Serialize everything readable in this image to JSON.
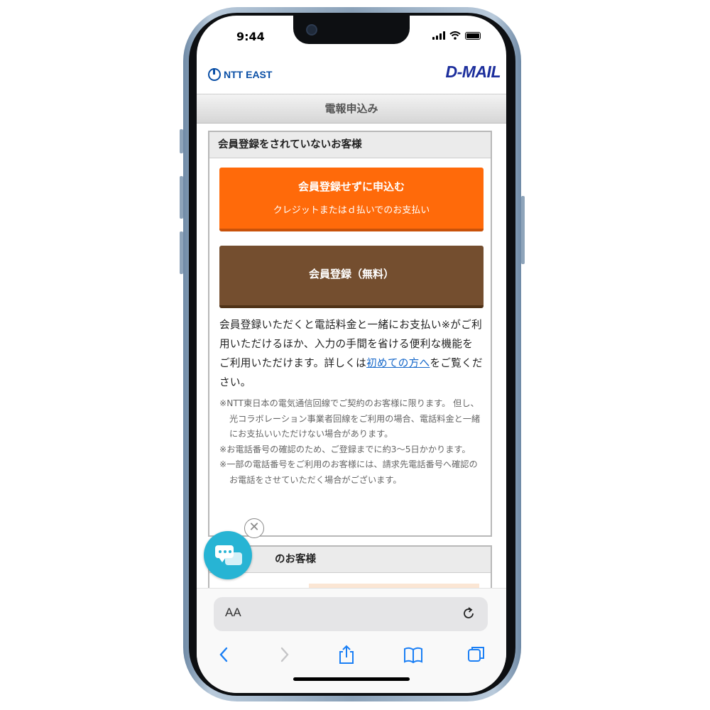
{
  "status": {
    "time": "9:44"
  },
  "header": {
    "ntt_logo": "NTT EAST",
    "dmail_logo": "D-MAIL",
    "title": "電報申込み"
  },
  "section_non_member": {
    "heading": "会員登録をされていないお客様",
    "order_button_title": "会員登録せずに申込む",
    "order_button_sub": "クレジットまたはｄ払いでのお支払い",
    "register_button": "会員登録（無料）",
    "description_before": "会員登録いただくと電話料金と一緒にお支払い※がご利用いただけるほか、入力の手間を省ける便利な機能をご利用いただけます。詳しくは",
    "description_link": "初めての方へ",
    "description_after": "をご覧ください。",
    "notes": [
      "※NTT東日本の電気通信回線でご契約のお客様に限ります。 但し、光コラボレーション事業者回線をご利用の場合、電話料金と一緒にお支払いいただけない場合があります。",
      "※お電話番号の確認のため、ご登録までに約3〜5日かかります。",
      "※一部の電話番号をご利用のお客様には、請求先電話番号へ確認のお電話をさせていただく場合がございます。"
    ]
  },
  "section_member": {
    "heading_visible": "のお客様"
  },
  "safari": {
    "text_size_label": "AA"
  },
  "colors": {
    "orange": "#ff6a0a",
    "brown": "#744e2f",
    "link": "#1366c9",
    "chat": "#27b4d4"
  }
}
